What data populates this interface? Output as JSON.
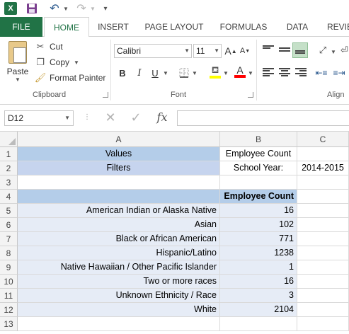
{
  "app": {
    "logo_letter": "X",
    "accent": "#217346"
  },
  "tabs": [
    "FILE",
    "HOME",
    "INSERT",
    "PAGE LAYOUT",
    "FORMULAS",
    "DATA",
    "REVIE"
  ],
  "ribbon": {
    "clipboard": {
      "paste": "Paste",
      "cut": "Cut",
      "copy": "Copy",
      "format_painter": "Format Painter",
      "label": "Clipboard"
    },
    "font": {
      "name": "Calibri",
      "size": "11",
      "label": "Font",
      "bold": "B",
      "italic": "I",
      "underline": "U",
      "font_color": "A",
      "grow": "A",
      "shrink": "A",
      "fill_color": "#ffff00",
      "font_color_bar": "#ff0000"
    },
    "alignment": {
      "label": "Align"
    }
  },
  "formula_bar": {
    "cell_ref": "D12",
    "cancel": "✕",
    "enter": "✓",
    "fx": "fx",
    "value": ""
  },
  "columns": [
    "A",
    "B",
    "C"
  ],
  "rows": [
    "1",
    "2",
    "3",
    "4",
    "5",
    "6",
    "7",
    "8",
    "9",
    "10",
    "11",
    "12",
    "13"
  ],
  "sheet": {
    "values_label": "Values",
    "values_value": "Employee Count",
    "filters_label": "Filters",
    "filters_field": "School Year:",
    "filters_value": "2014-2015",
    "table_header": "Employee Count",
    "table": [
      {
        "category": "American Indian or Alaska Native",
        "count": "16"
      },
      {
        "category": "Asian",
        "count": "102"
      },
      {
        "category": "Black or African American",
        "count": "771"
      },
      {
        "category": "Hispanic/Latino",
        "count": "1238"
      },
      {
        "category": "Native Hawaiian / Other Pacific Islander",
        "count": "1"
      },
      {
        "category": "Two or more races",
        "count": "16"
      },
      {
        "category": "Unknown Ethnicity / Race",
        "count": "3"
      },
      {
        "category": "White",
        "count": "2104"
      }
    ]
  },
  "colors": {
    "values_fill": "#b4cde9",
    "filters_fill": "#c6d4ee",
    "header_fill": "#b4cde9",
    "body_fill": "#e6ecf6"
  }
}
